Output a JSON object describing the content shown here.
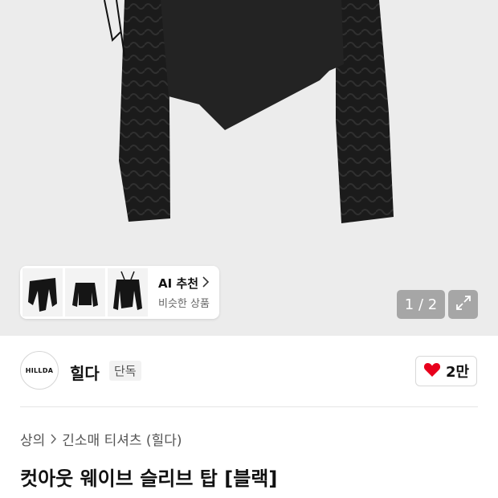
{
  "gallery": {
    "counter": "1 / 2",
    "recommendation": {
      "title": "AI 추천",
      "subtitle": "비슷한 상품",
      "thumbnails": [
        "reco-thumbnail-1",
        "reco-thumbnail-2",
        "reco-thumbnail-3"
      ]
    },
    "icons": [
      "chevron-right-icon",
      "expand-icon"
    ]
  },
  "brand": {
    "logo_text": "HILLDA",
    "name": "힐다",
    "badge": "단독",
    "likes": "2만",
    "like_icon": "heart-icon",
    "like_color": "#e8001c"
  },
  "breadcrumb": {
    "category": "상의",
    "subcategory": "긴소매 티셔츠 (힐다)",
    "separator_icon": "chevron-right-icon"
  },
  "product": {
    "title": "컷아웃 웨이브 슬리브 탑 [블랙]"
  }
}
